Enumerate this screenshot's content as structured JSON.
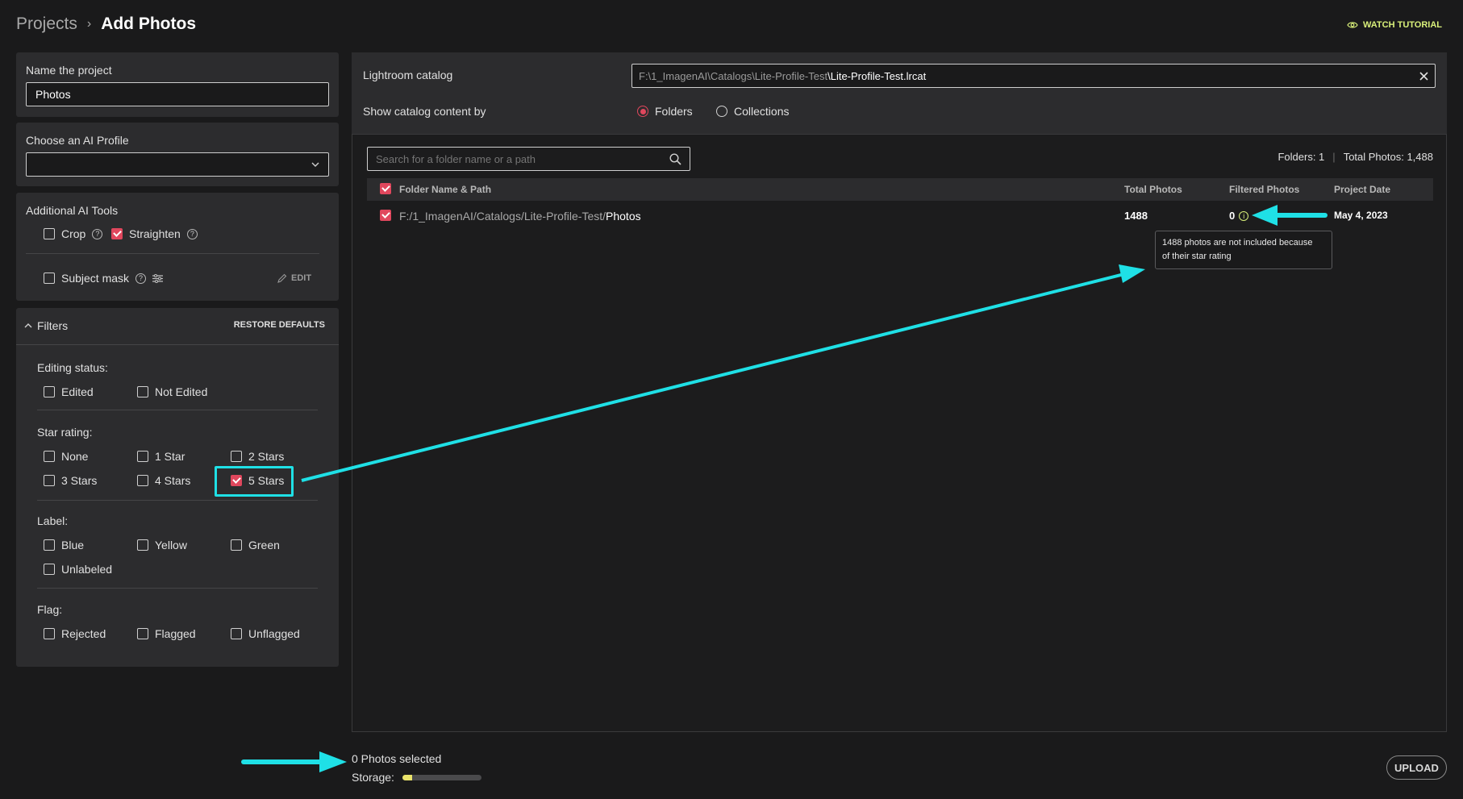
{
  "header": {
    "breadcrumb_root": "Projects",
    "breadcrumb_sep": "›",
    "breadcrumb_current": "Add Photos",
    "watch_tutorial": "WATCH TUTORIAL"
  },
  "project": {
    "name_label": "Name the project",
    "name_value": "Photos",
    "ai_profile_label": "Choose an AI Profile",
    "ai_profile_value": ""
  },
  "ai_tools": {
    "title": "Additional AI Tools",
    "crop": "Crop",
    "straighten": "Straighten",
    "subject_mask": "Subject mask",
    "edit": "EDIT"
  },
  "filters": {
    "title": "Filters",
    "restore": "RESTORE DEFAULTS",
    "editing_status": {
      "label": "Editing status:",
      "options": [
        "Edited",
        "Not Edited"
      ]
    },
    "star_rating": {
      "label": "Star rating:",
      "options": [
        "None",
        "1 Star",
        "2 Stars",
        "3 Stars",
        "4 Stars",
        "5 Stars"
      ]
    },
    "label": {
      "label": "Label:",
      "options": [
        "Blue",
        "Yellow",
        "Green",
        "Unlabeled"
      ]
    },
    "flag": {
      "label": "Flag:",
      "options": [
        "Rejected",
        "Flagged",
        "Unflagged"
      ]
    }
  },
  "catalog": {
    "label": "Lightroom catalog",
    "path_dim": "F:\\1_ImagenAI\\Catalogs\\Lite-Profile-Test",
    "path_bright": "\\Lite-Profile-Test.lrcat",
    "show_by_label": "Show catalog content by",
    "opt_folders": "Folders",
    "opt_collections": "Collections"
  },
  "search": {
    "placeholder": "Search for a folder name or a path"
  },
  "summary": {
    "folders": "Folders: 1",
    "sep": "|",
    "total": "Total Photos: 1,488"
  },
  "table": {
    "headers": [
      "Folder Name & Path",
      "Total Photos",
      "Filtered Photos",
      "Project Date"
    ],
    "rows": [
      {
        "path_dim": "F:/1_ImagenAI/Catalogs/Lite-Profile-Test/",
        "path_bright": "Photos",
        "total": "1488",
        "filtered": "0",
        "date": "May 4, 2023"
      }
    ]
  },
  "tooltip": {
    "line1": "1488 photos are not included because",
    "line2": "of their star rating"
  },
  "footer": {
    "selected": "0 Photos selected",
    "storage_label": "Storage:",
    "storage_fraction": 0.12,
    "upload": "UPLOAD"
  },
  "colors": {
    "accent": "#e0475d",
    "annotation": "#1fe0e6",
    "tutorial": "#d9f07a",
    "storage_fill": "#e9e36a"
  }
}
